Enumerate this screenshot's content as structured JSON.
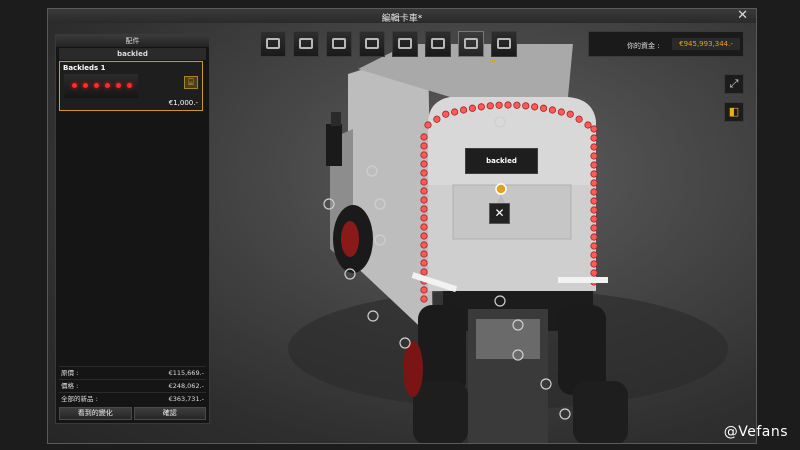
{
  "window": {
    "title": "編輯卡車*",
    "close_label": "✕"
  },
  "left_panel": {
    "header": "配件",
    "subheader": "backled",
    "item": {
      "name": "Backleds 1",
      "price": "€1,000.-",
      "cart_icon": "cart-icon"
    },
    "totals": [
      {
        "label": "原價 :",
        "value": "€115,669.-"
      },
      {
        "label": "價格 :",
        "value": "€248,062.-"
      },
      {
        "label": "全部的新品 :",
        "value": "€363,731.-"
      }
    ],
    "buttons": {
      "visible_changes": "看到的變化",
      "confirm": "確認"
    }
  },
  "money": {
    "label": "你的資金 :",
    "value": "€945,993,344.-"
  },
  "toolbar": {
    "icons": [
      "cab-icon",
      "chassis-icon",
      "engine-icon",
      "transmission-icon",
      "paint-icon",
      "interior-icon",
      "accessories-icon",
      "wheels-icon"
    ],
    "active_index": 6
  },
  "side_buttons": {
    "fullscreen": "fullscreen-icon",
    "light": "headlight-icon"
  },
  "viewport": {
    "tooltip": "backled",
    "remove_icon": "remove-icon"
  },
  "watermark": "@Vefans",
  "colors": {
    "accent": "#d19a18",
    "money": "#e8a020",
    "led": "#ff2a2a"
  }
}
